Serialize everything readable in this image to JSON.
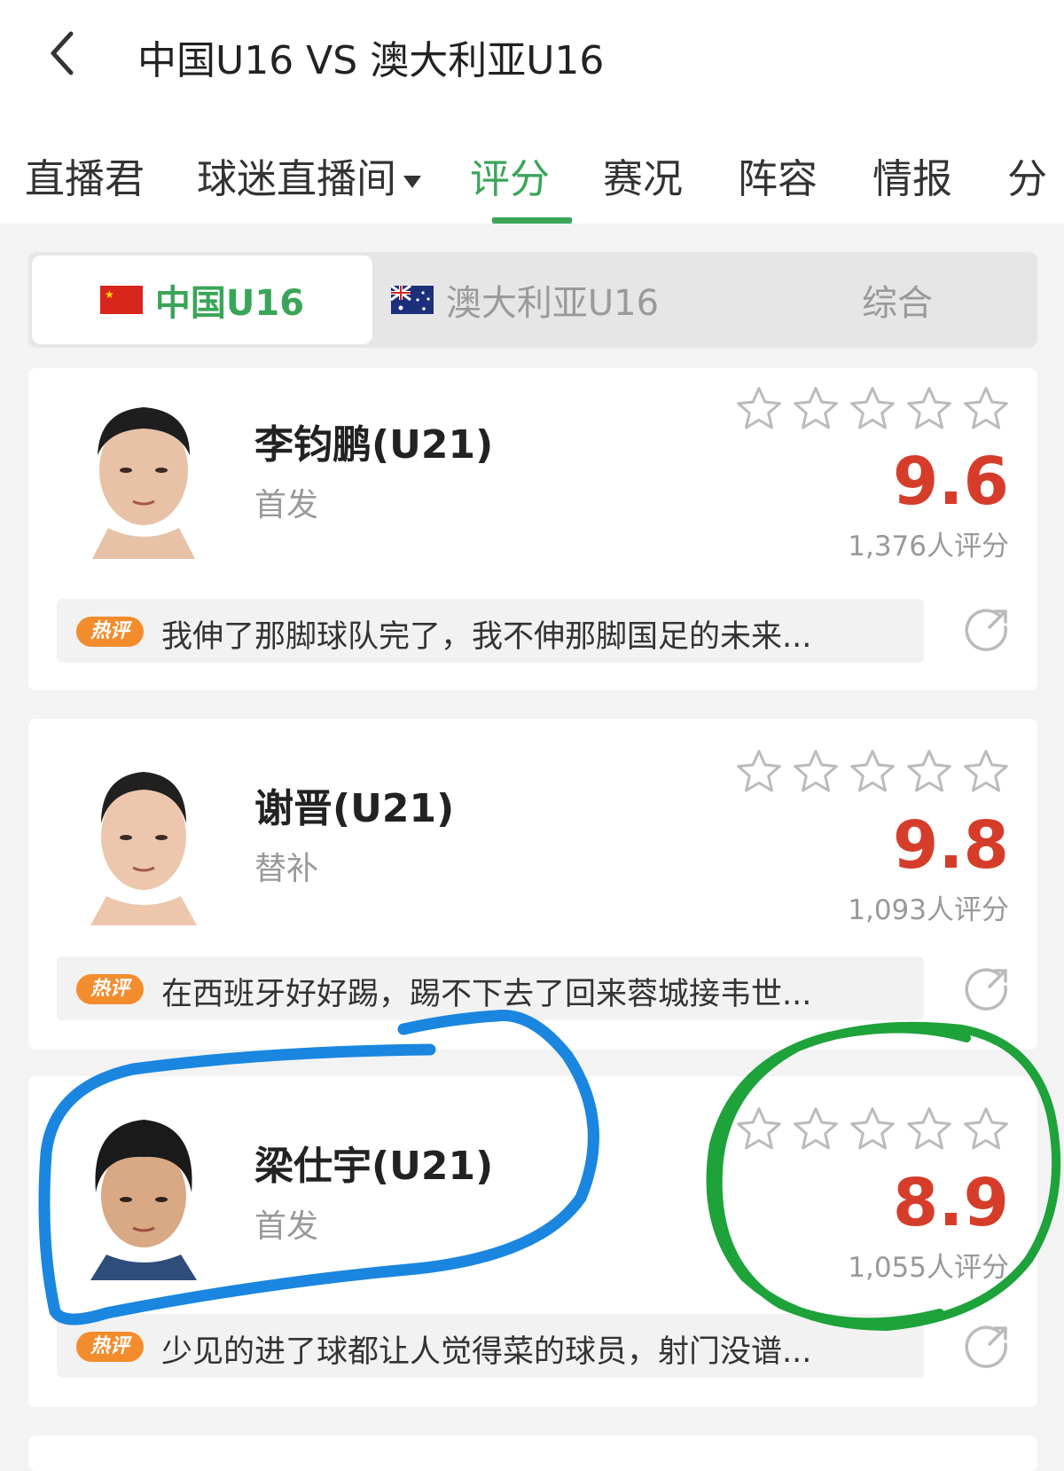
{
  "header": {
    "title": "中国U16 VS 澳大利亚U16"
  },
  "tabs": [
    {
      "label": "直播君"
    },
    {
      "label": "球迷直播间"
    },
    {
      "label": "评分"
    },
    {
      "label": "赛况"
    },
    {
      "label": "阵容"
    },
    {
      "label": "情报"
    },
    {
      "label": "分"
    }
  ],
  "segments": [
    {
      "label": "中国U16",
      "selected": true
    },
    {
      "label": "澳大利亚U16"
    },
    {
      "label": "综合"
    }
  ],
  "players": [
    {
      "name": "李钧鹏(U21)",
      "role": "首发",
      "score": "9.6",
      "ratings": "1,376人评分",
      "hot_label": "热评",
      "comment": "我伸了那脚球队完了，我不伸那脚国足的未来..."
    },
    {
      "name": "谢晋(U21)",
      "role": "替补",
      "score": "9.8",
      "ratings": "1,093人评分",
      "hot_label": "热评",
      "comment": "在西班牙好好踢，踢不下去了回来蓉城接韦世..."
    },
    {
      "name": "梁仕宇(U21)",
      "role": "首发",
      "score": "8.9",
      "ratings": "1,055人评分",
      "hot_label": "热评",
      "comment": "少见的进了球都让人觉得菜的球员，射门没谱..."
    }
  ],
  "colors": {
    "accent": "#3aa558",
    "score": "#d53d2a",
    "hot_badge": "#f28c2d",
    "annotation_blue": "#1a86e0",
    "annotation_green": "#1ea23a"
  }
}
